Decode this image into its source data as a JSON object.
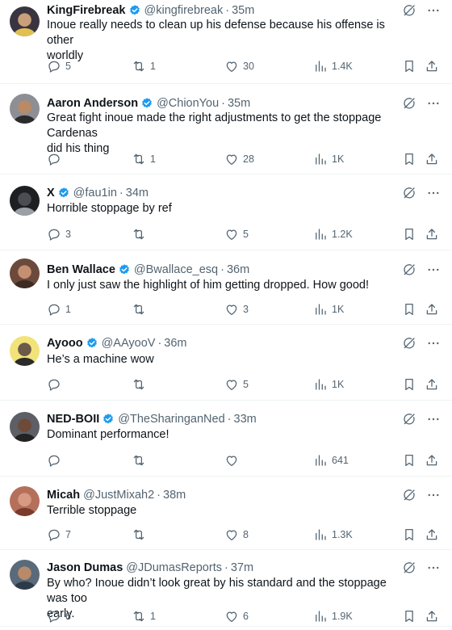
{
  "colors": {
    "text": "#0f1419",
    "secondary": "#536471",
    "verified": "#1d9bf0",
    "divider": "#eff3f4"
  },
  "icons": {
    "reply": "reply-icon",
    "retweet": "retweet-icon",
    "like": "heart-icon",
    "views": "views-icon",
    "bookmark": "bookmark-icon",
    "share": "share-icon",
    "grok": "grok-icon",
    "more": "more-icon",
    "verified": "verified-badge-icon"
  },
  "tweets": [
    {
      "name": "KingFirebreak",
      "handle": "@kingfirebreak",
      "time": "35m",
      "verified": true,
      "text": [
        "Inoue really needs to clean up his defense because his offense is other",
        "worldly"
      ],
      "replies": "5",
      "retweets": "1",
      "likes": "30",
      "views": "1.4K"
    },
    {
      "name": "Aaron Anderson",
      "handle": "@ChionYou",
      "time": "35m",
      "verified": true,
      "text": [
        "Great fight inoue made the right adjustments to get the stoppage Cardenas",
        "did his thing"
      ],
      "replies": "",
      "retweets": "1",
      "likes": "28",
      "views": "1K"
    },
    {
      "name": "X",
      "handle": "@fau1in",
      "time": "34m",
      "verified": true,
      "text": [
        "Horrible stoppage by ref"
      ],
      "replies": "3",
      "retweets": "",
      "likes": "5",
      "views": "1.2K"
    },
    {
      "name": "Ben Wallace",
      "handle": "@Bwallace_esq",
      "time": "36m",
      "verified": true,
      "text": [
        "I only just saw the highlight of him getting dropped. How good!"
      ],
      "replies": "1",
      "retweets": "",
      "likes": "3",
      "views": "1K"
    },
    {
      "name": "Ayooo",
      "handle": "@AAyooV",
      "time": "36m",
      "verified": true,
      "text": [
        "He’s a machine wow"
      ],
      "replies": "",
      "retweets": "",
      "likes": "5",
      "views": "1K"
    },
    {
      "name": "NED-BOII",
      "handle": "@TheSharinganNed",
      "time": "33m",
      "verified": true,
      "text": [
        "Dominant performance!"
      ],
      "replies": "",
      "retweets": "",
      "likes": "",
      "views": "641"
    },
    {
      "name": "Micah",
      "handle": "@JustMixah2",
      "time": "38m",
      "verified": false,
      "text": [
        "Terrible stoppage"
      ],
      "replies": "7",
      "retweets": "",
      "likes": "8",
      "views": "1.3K"
    },
    {
      "name": "Jason Dumas",
      "handle": "@JDumasReports",
      "time": "37m",
      "verified": false,
      "text": [
        "By who? Inoue didn’t look great by his standard and the stoppage was too",
        "early."
      ],
      "replies": "6",
      "retweets": "1",
      "likes": "6",
      "views": "1.9K"
    }
  ]
}
